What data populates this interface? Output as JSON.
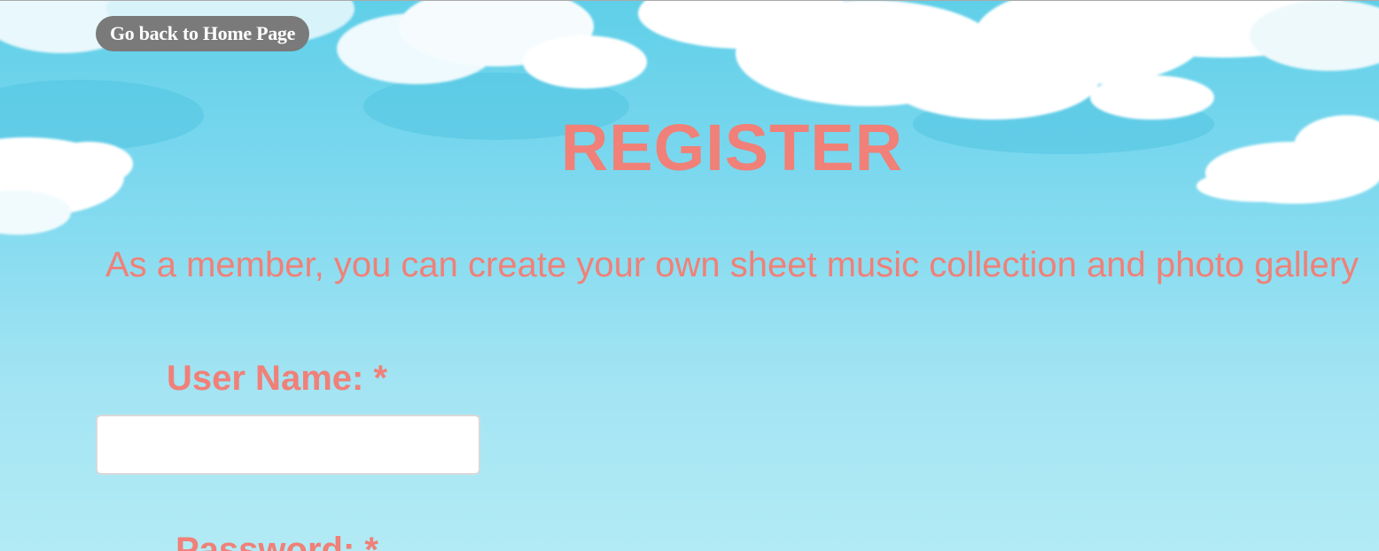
{
  "nav": {
    "back_label": "Go back to Home Page"
  },
  "page": {
    "title": "REGISTER",
    "intro": "As a member, you can create your own sheet music collection and photo gallery"
  },
  "form": {
    "username_label": "User Name: *",
    "username_value": "",
    "password_label": "Password: *"
  },
  "theme": {
    "accent_color": "#f08078",
    "button_color": "#7a7a7a",
    "sky_top": "#5fcfe8",
    "sky_bottom": "#b2ebf5",
    "background": "sky-with-clouds"
  }
}
